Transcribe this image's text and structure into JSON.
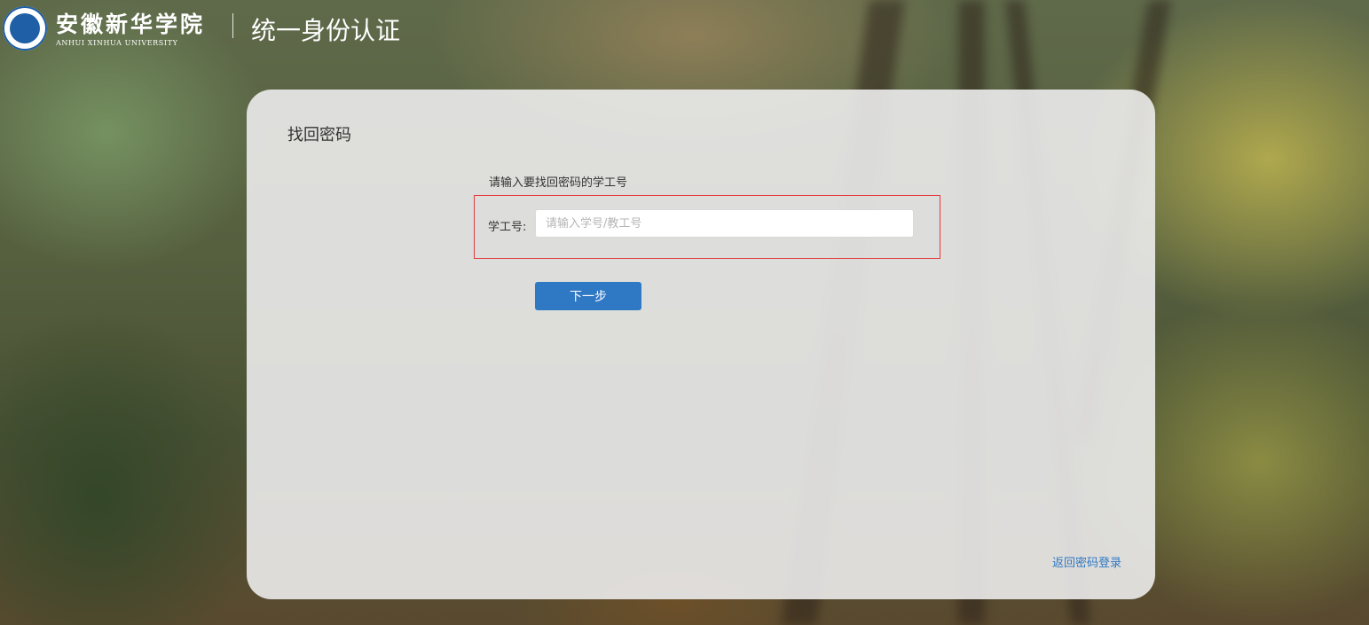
{
  "header": {
    "school_name_cn": "安徽新华学院",
    "school_name_en": "ANHUI XINHUA UNIVERSITY",
    "system_title": "统一身份认证"
  },
  "panel": {
    "title": "找回密码",
    "instruction": "请输入要找回密码的学工号",
    "field_label": "学工号:",
    "field_placeholder": "请输入学号/教工号",
    "field_value": "",
    "next_button": "下一步",
    "back_link": "返回密码登录"
  },
  "colors": {
    "primary": "#2f78c4",
    "highlight_border": "#e4393c",
    "panel_bg": "#ececec"
  },
  "icons": {
    "logo": "university-seal-icon"
  }
}
